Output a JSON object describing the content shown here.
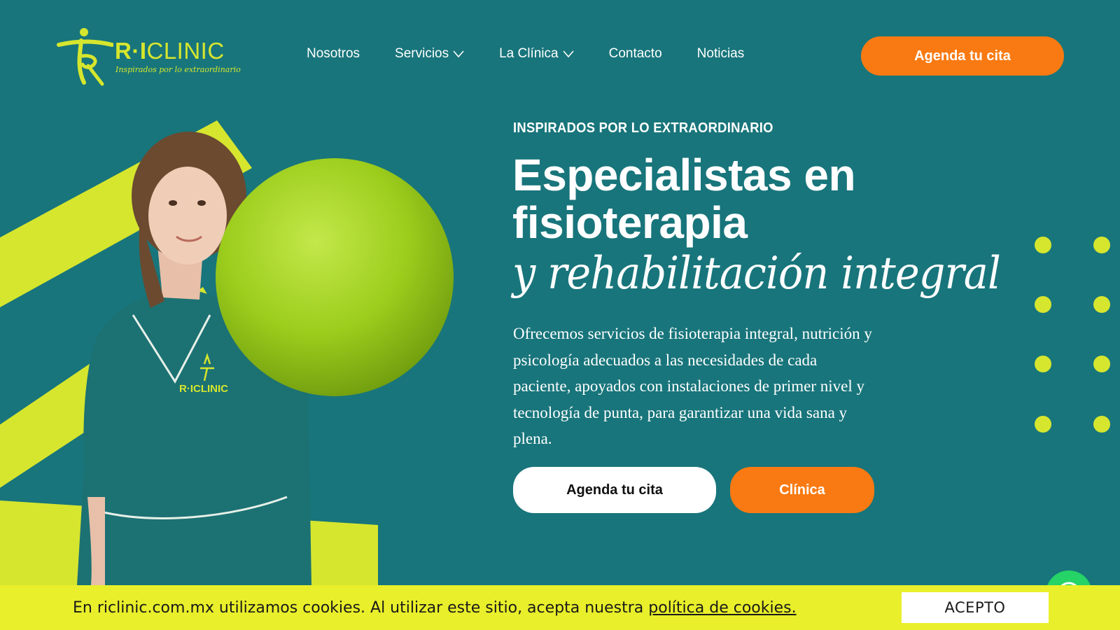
{
  "brand": {
    "name_bold": "R·I",
    "name_rest": "CLINIC",
    "tagline": "Inspirados por lo extraordinario",
    "accent_color": "#d6e62e",
    "primary_color": "#18757b",
    "cta_color": "#f97a12"
  },
  "nav": {
    "items": [
      {
        "label": "Nosotros",
        "has_dropdown": false
      },
      {
        "label": "Servicios",
        "has_dropdown": true
      },
      {
        "label": "La Clínica",
        "has_dropdown": true
      },
      {
        "label": "Contacto",
        "has_dropdown": false
      },
      {
        "label": "Noticias",
        "has_dropdown": false
      }
    ],
    "cta_label": "Agenda tu cita"
  },
  "hero": {
    "eyebrow": "INSPIRADOS POR LO EXTRAORDINARIO",
    "headline": "Especialistas en fisioterapia",
    "headline_italic": "y rehabilitación integral",
    "description": "Ofrecemos servicios de fisioterapia integral, nutrición y psicología adecuados a las necesidades de cada paciente, apoyados con instalaciones de primer nivel y tecnología de punta, para garantizar una vida sana y plena.",
    "primary_button": "Agenda tu cita",
    "secondary_button": "Clínica",
    "uniform_logo_text": "R·ICLINIC",
    "image": "physiotherapist-holding-green-ball"
  },
  "cookie": {
    "text": "En riclinic.com.mx utilizamos cookies. Al utilizar este sitio, acepta nuestra ",
    "link_label": "política de cookies.",
    "accept_label": "ACEPTO"
  },
  "icons": {
    "chevron": "chevron-down-icon",
    "whatsapp": "whatsapp-icon"
  }
}
